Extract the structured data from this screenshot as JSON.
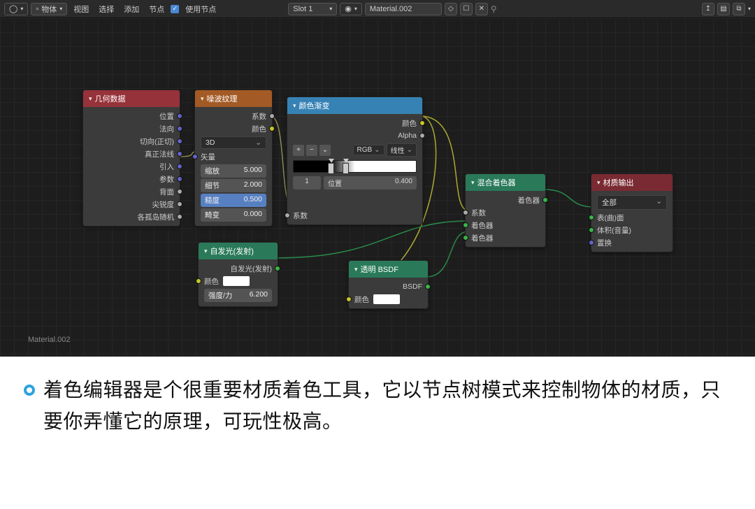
{
  "header": {
    "mode": "物体",
    "menus": [
      "视图",
      "选择",
      "添加",
      "节点"
    ],
    "use_nodes_label": "使用节点",
    "slot": "Slot 1",
    "material": "Material.002"
  },
  "canvas_label": "Material.002",
  "nodes": {
    "geometry": {
      "title": "几何数据",
      "outputs": [
        "位置",
        "法向",
        "切向(正切)",
        "真正法线",
        "引入",
        "参数",
        "背面",
        "尖锐度",
        "各孤岛随机"
      ]
    },
    "noise": {
      "title": "噪波纹理",
      "out_fac": "系数",
      "out_color": "颜色",
      "dim": "3D",
      "in_vector": "矢量",
      "scale_label": "缩放",
      "scale_val": "5.000",
      "detail_label": "细节",
      "detail_val": "2.000",
      "rough_label": "糙度",
      "rough_val": "0.500",
      "distort_label": "畸变",
      "distort_val": "0.000"
    },
    "ramp": {
      "title": "颜色渐变",
      "out_color": "颜色",
      "out_alpha": "Alpha",
      "mode_rgb": "RGB",
      "mode_interp": "线性",
      "plus": "+",
      "minus": "−",
      "idx": "1",
      "pos_label": "位置",
      "pos_val": "0.400",
      "in_fac": "系数"
    },
    "emission": {
      "title": "自发光(发射)",
      "out": "自发光(发射)",
      "in_color": "颜色",
      "strength_label": "强度/力",
      "strength_val": "6.200"
    },
    "transparent": {
      "title": "透明 BSDF",
      "out": "BSDF",
      "in_color": "颜色"
    },
    "mix": {
      "title": "混合着色器",
      "out": "着色器",
      "in_fac": "系数",
      "in_shader1": "着色器",
      "in_shader2": "着色器"
    },
    "output": {
      "title": "材质输出",
      "target": "全部",
      "in_surface": "表(曲)面",
      "in_volume": "体积(音量)",
      "in_disp": "置换"
    }
  },
  "caption": "着色编辑器是个很重要材质着色工具，它以节点树模式来控制物体的材质，只要你弄懂它的原理，可玩性极高。"
}
